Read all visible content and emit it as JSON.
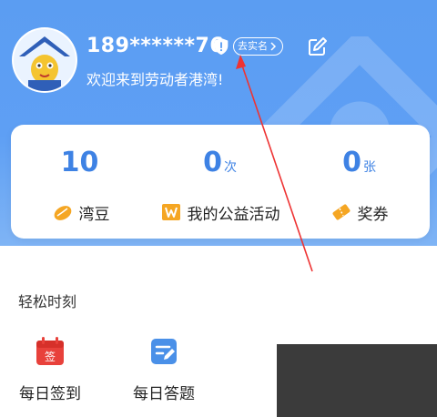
{
  "header": {
    "phone": "189******76",
    "verify_label": "去实名",
    "welcome": "欢迎来到劳动者港湾!"
  },
  "stats": [
    {
      "value": "10",
      "unit": "",
      "label": "湾豆",
      "icon": "bean-icon"
    },
    {
      "value": "0",
      "unit": "次",
      "label": "我的公益活动",
      "icon": "charity-icon"
    },
    {
      "value": "0",
      "unit": "张",
      "label": "奖券",
      "icon": "coupon-icon"
    }
  ],
  "section": {
    "title": "轻松时刻",
    "items": [
      {
        "label": "每日签到",
        "icon": "calendar-sign-icon",
        "badge": "签"
      },
      {
        "label": "每日答题",
        "icon": "quiz-icon"
      }
    ]
  },
  "colors": {
    "header_blue": "#5b9df2",
    "accent": "#3e82e4",
    "red": "#e8413b",
    "orange": "#f5a623"
  }
}
